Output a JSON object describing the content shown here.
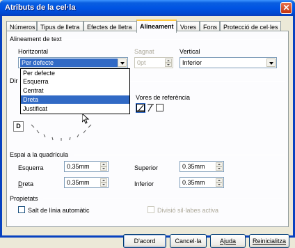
{
  "window": {
    "title": "Atributs de la cel·la"
  },
  "tabs": [
    {
      "label": "Números"
    },
    {
      "label": "Tipus de lletra"
    },
    {
      "label": "Efectes de lletra"
    },
    {
      "label": "Alineament"
    },
    {
      "label": "Vores"
    },
    {
      "label": "Fons"
    },
    {
      "label": "Protecció de cel·les"
    }
  ],
  "text_alignment": {
    "group_label": "Alineament de text",
    "horizontal_label": "Horitzontal",
    "horizontal_value": "Per defecte",
    "horizontal_options": [
      "Per defecte",
      "Esquerra",
      "Centrat",
      "Dreta",
      "Justificat"
    ],
    "highlighted_option": "Dreta",
    "indent_label": "Sagnat",
    "indent_value": "0pt",
    "vertical_label": "Vertical",
    "vertical_value": "Inferior"
  },
  "text_direction": {
    "group_label_partial": "Dir",
    "reference_edges_label": "Vores de referència",
    "orientation_letter": "D"
  },
  "spacing": {
    "group_label": "Espai a la quadrícula",
    "left_label": "Esquerra",
    "left_value": "0.35mm",
    "right_label": "Dreta",
    "right_value": "0.35mm",
    "top_label": "Superior",
    "top_value": "0.35mm",
    "bottom_label": "Inferior",
    "bottom_value": "0.35mm"
  },
  "properties": {
    "group_label": "Propietats",
    "wrap_label": "Salt de línia automàtic",
    "hyphenation_label": "Divisió sil·labes activa"
  },
  "buttons": {
    "ok": "D'acord",
    "cancel": "Cancel·la",
    "help": "Ajuda",
    "reset": "Reinicialitza"
  }
}
